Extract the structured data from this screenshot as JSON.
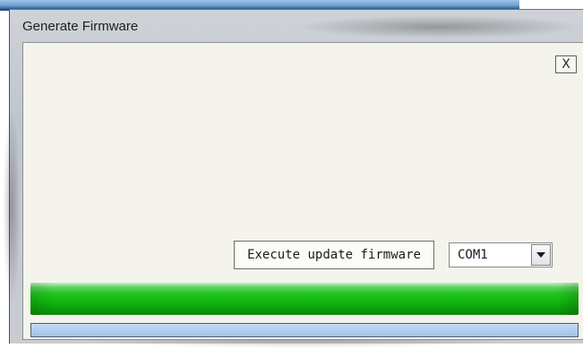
{
  "window": {
    "title": "Generate Firmware",
    "close_label": "X"
  },
  "actions": {
    "execute_label": "Execute update firmware"
  },
  "port": {
    "selected": "COM1"
  },
  "progress": {
    "primary_fraction": 1.0,
    "secondary_fraction": 0.0,
    "primary_color": "#14b814",
    "secondary_color": "#a9c8ee"
  },
  "icons": {
    "close": "close-icon",
    "dropdown": "chevron-down-icon"
  }
}
